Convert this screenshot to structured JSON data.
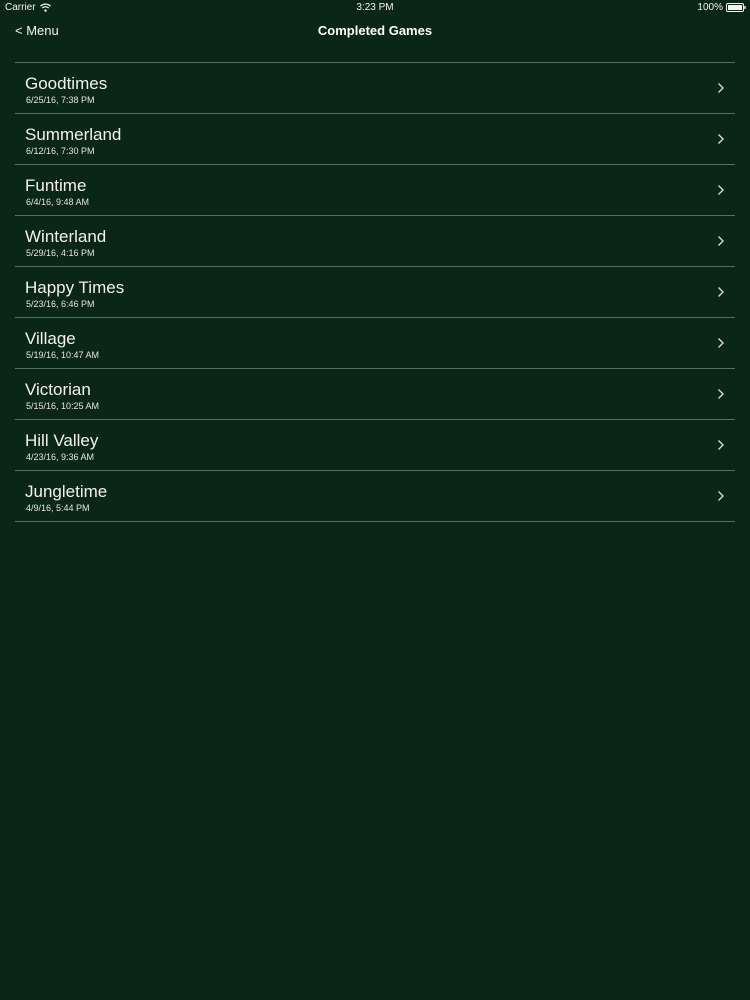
{
  "status_bar": {
    "carrier": "Carrier",
    "time": "3:23 PM",
    "battery": "100%",
    "icons": [
      "wifi-icon",
      "battery-icon"
    ]
  },
  "nav": {
    "back_label": "< Menu",
    "title": "Completed Games"
  },
  "games": [
    {
      "name": "Goodtimes",
      "date": "6/25/16, 7:38 PM"
    },
    {
      "name": "Summerland",
      "date": "6/12/16, 7:30 PM"
    },
    {
      "name": "Funtime",
      "date": "6/4/16, 9:48 AM"
    },
    {
      "name": "Winterland",
      "date": "5/29/16, 4:16 PM"
    },
    {
      "name": "Happy Times",
      "date": "5/23/16, 6:46 PM"
    },
    {
      "name": "Village",
      "date": "5/19/16, 10:47 AM"
    },
    {
      "name": "Victorian",
      "date": "5/15/16, 10:25 AM"
    },
    {
      "name": "Hill Valley",
      "date": "4/23/16, 9:36 AM"
    },
    {
      "name": "Jungletime",
      "date": "4/9/16, 5:44 PM"
    }
  ],
  "colors": {
    "background": "#0a2614",
    "separator": "#5a6e5f",
    "text": "#f2f2f2"
  }
}
